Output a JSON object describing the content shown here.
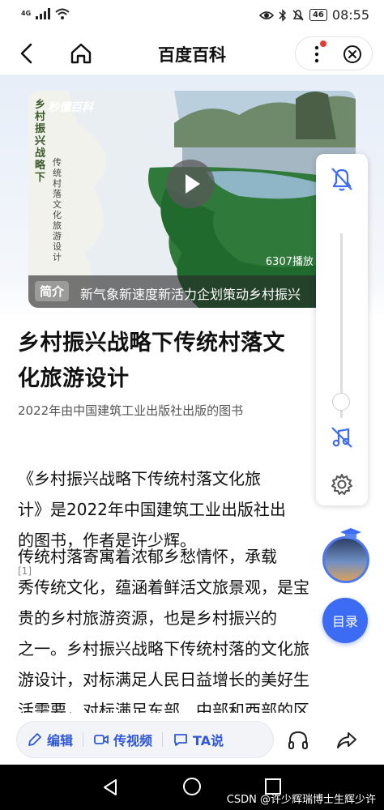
{
  "status_bar": {
    "network": "4G",
    "battery": "46",
    "time": "08:55"
  },
  "nav": {
    "title": "百度百科"
  },
  "video": {
    "side_title": "乡村振兴战略下",
    "side_subtitle": "传统村落文化旅游设计",
    "logo": "秒懂百科",
    "play_count": "6307播放",
    "intro_label": "简介",
    "intro_text": "新气象新速度新活力企划策动乡村振兴"
  },
  "article": {
    "title": "乡村振兴战略下传统村落文\n化旅游设计",
    "subtitle": "2022年由中国建筑工业出版社出版的图书",
    "para1": "《乡村振兴战略下传统村落文化旅\n计》是2022年中国建筑工业出版社出\n的图书，作者是许少辉。",
    "cite": "[1]",
    "para2": "传统村落寄寓着浓郁乡愁情怀，承载\n秀传统文化，蕴涵着鲜活文旅景观，是宝\n贵的乡村旅游资源，也是乡村振兴的\n之一。乡村振兴战略下传统村落的文化旅\n游设计，对标满足人民日益增长的美好生\n活需要，对标满足东部、中部和西部的区"
  },
  "floating": {
    "toc_label": "目录"
  },
  "bottom_bar": {
    "edit": "编辑",
    "video": "传视频",
    "ta": "TA说"
  },
  "watermark": "CSDN @许少辉瑞博士生辉少许",
  "colors": {
    "accent": "#3c6cf4",
    "action_text": "#3058d6",
    "notice_red": "#e53935"
  }
}
